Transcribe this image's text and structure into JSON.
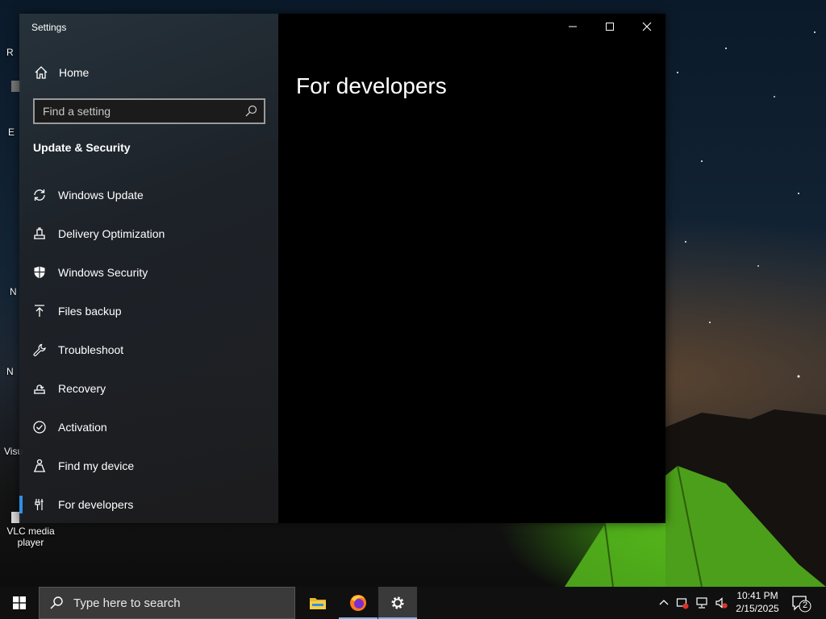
{
  "desktop": {
    "icons": [
      {
        "name": "recycle-bin",
        "label": "R"
      },
      {
        "name": "edge",
        "label": "E"
      },
      {
        "name": "unknown-1",
        "label": ""
      },
      {
        "name": "n-app",
        "label": "N"
      },
      {
        "name": "n-app-2",
        "label": "N"
      },
      {
        "name": "visual-studio",
        "label": "Visu"
      },
      {
        "name": "vlc",
        "label": "VLC media player"
      }
    ]
  },
  "window": {
    "app_title": "Settings",
    "home_label": "Home",
    "search_placeholder": "Find a setting",
    "section_title": "Update & Security",
    "nav_items": [
      {
        "label": "Windows Update",
        "icon": "sync-icon"
      },
      {
        "label": "Delivery Optimization",
        "icon": "delivery-icon"
      },
      {
        "label": "Windows Security",
        "icon": "shield-icon"
      },
      {
        "label": "Files backup",
        "icon": "upload-icon"
      },
      {
        "label": "Troubleshoot",
        "icon": "wrench-icon"
      },
      {
        "label": "Recovery",
        "icon": "recovery-icon"
      },
      {
        "label": "Activation",
        "icon": "check-circle-icon"
      },
      {
        "label": "Find my device",
        "icon": "person-icon"
      },
      {
        "label": "For developers",
        "icon": "developer-icon",
        "selected": true
      }
    ],
    "page_title": "For developers"
  },
  "taskbar": {
    "search_text": "Type here to search",
    "pinned_apps": [
      "File Explorer",
      "Firefox",
      "Settings"
    ],
    "clock_time": "10:41 PM",
    "clock_date": "2/15/2025",
    "notification_count": "2"
  },
  "colors": {
    "accent": "#2f8fe6",
    "main_bg": "#000000",
    "taskbar_bg": "#101010"
  }
}
